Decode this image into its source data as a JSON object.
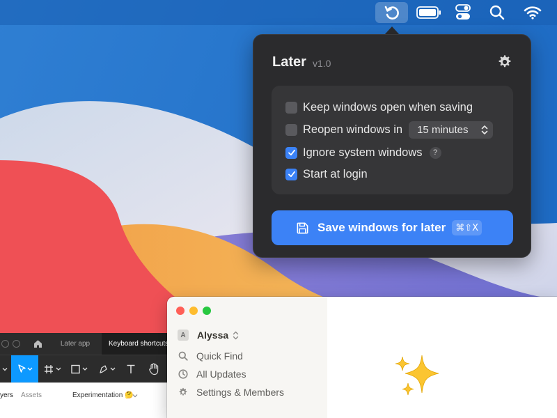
{
  "menubar": {
    "icons": [
      "later-restore-icon",
      "battery-icon",
      "control-center-icon",
      "spotlight-search-icon",
      "wifi-icon"
    ]
  },
  "popover": {
    "title": "Later",
    "version": "v1.0",
    "options": [
      {
        "label": "Keep windows open when saving",
        "checked": false
      },
      {
        "label": "Reopen windows in",
        "checked": false,
        "select_value": "15 minutes"
      },
      {
        "label": "Ignore system windows",
        "checked": true,
        "help": "?"
      },
      {
        "label": "Start at login",
        "checked": true
      }
    ],
    "save_button": {
      "label": "Save windows for later",
      "shortcut": "⌘⇧X"
    }
  },
  "figma": {
    "tabs": [
      "Later app",
      "Keyboard shortcuts"
    ],
    "panel_tabs": [
      "yers",
      "Assets",
      "Experimentation 🤔"
    ]
  },
  "notion": {
    "workspace": {
      "avatar": "A",
      "name": "Alyssa"
    },
    "sidebar": [
      "Quick Find",
      "All Updates",
      "Settings & Members"
    ]
  },
  "colors": {
    "accent": "#3c82f6",
    "popover_bg": "#2b2b2d",
    "options_bg": "#363638",
    "traffic_red": "#ff5f57",
    "traffic_yellow": "#febc2e",
    "traffic_green": "#28c840"
  }
}
